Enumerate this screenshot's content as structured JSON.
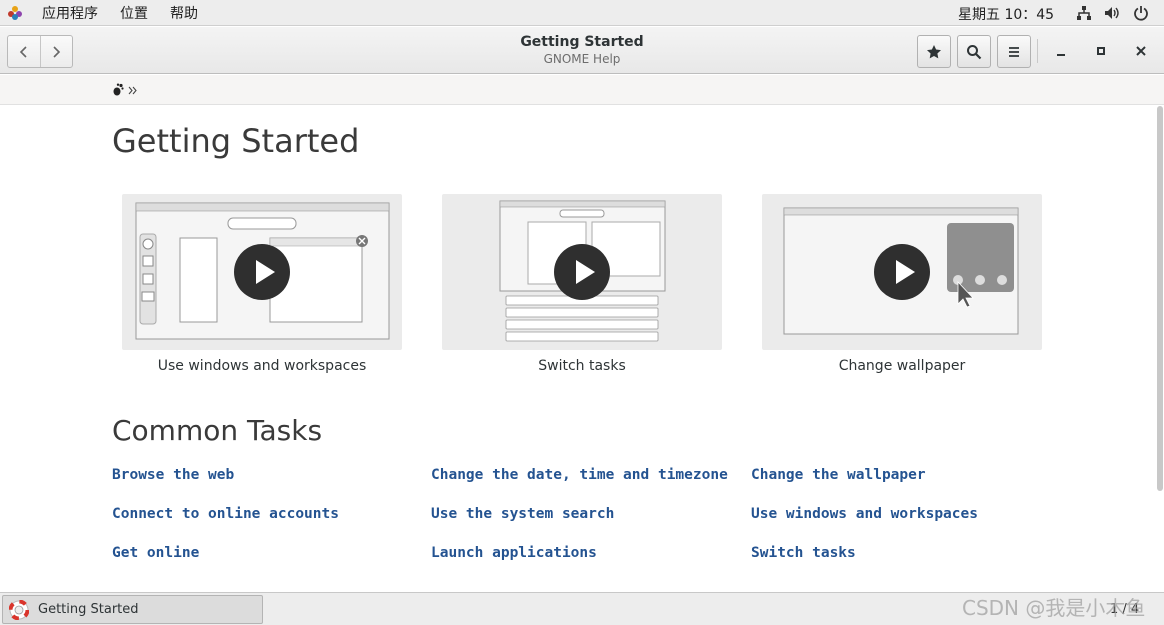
{
  "topbar": {
    "menus": [
      "应用程序",
      "位置",
      "帮助"
    ],
    "clock": "星期五 10：45"
  },
  "window": {
    "title": "Getting Started",
    "subtitle": "GNOME Help"
  },
  "page": {
    "heading": "Getting Started",
    "videos": [
      {
        "caption": "Use windows and workspaces"
      },
      {
        "caption": "Switch tasks"
      },
      {
        "caption": "Change wallpaper"
      }
    ],
    "section_heading": "Common Tasks",
    "tasks": [
      [
        "Browse the web",
        "Change the date, time and timezone",
        "Change the wallpaper"
      ],
      [
        "Connect to online accounts",
        "Use the system search",
        "Use windows and workspaces"
      ],
      [
        "Get online",
        "Launch applications",
        "Switch tasks"
      ]
    ]
  },
  "taskbar": {
    "task_label": "Getting Started",
    "pager": "1 / 4"
  },
  "watermark": "CSDN @我是小木鱼",
  "icons": {
    "apps": "gnome-foot-icon",
    "network": "network-icon",
    "volume": "volume-icon",
    "power": "power-icon",
    "help": "lifebuoy-icon"
  },
  "colors": {
    "link": "#245391",
    "video_bg": "#ebebeb",
    "play_bg": "#2f2f2f"
  }
}
